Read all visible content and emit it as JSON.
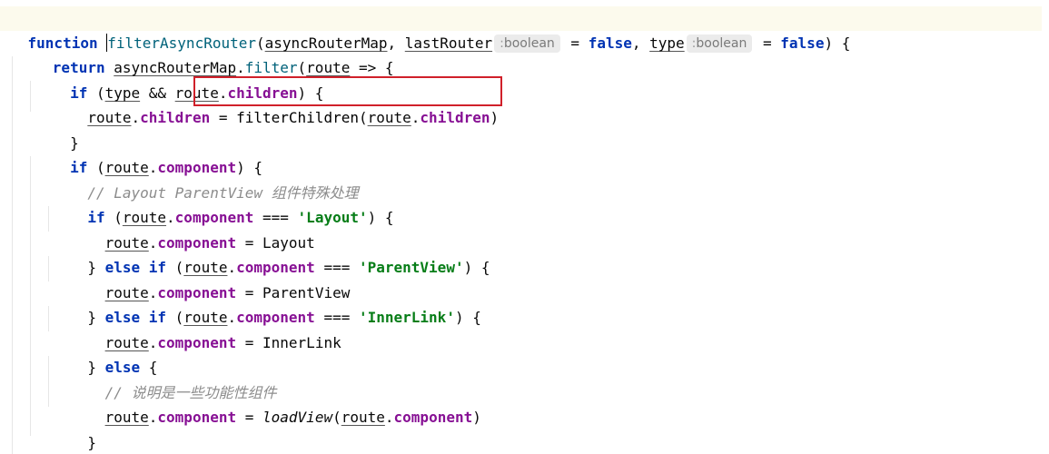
{
  "code": {
    "line1": {
      "kw_function": "function",
      "space1": " ",
      "fn_name": "filterAsyncRouter",
      "paren_open": "(",
      "param1": "asyncRouterMap",
      "comma1": ", ",
      "param2": "lastRouter",
      "hint1_colon": ":",
      "hint1_type": "boolean",
      "eq1": " = ",
      "false1": "false",
      "comma2": ", ",
      "param3": "type",
      "hint2_colon": ":",
      "hint2_type": "boolean",
      "eq2": " = ",
      "false2": "false",
      "tail": ") {"
    },
    "line2": {
      "indent": "  ",
      "kw_return": "return",
      "space": " ",
      "obj": "asyncRouterMap",
      "dot": ".",
      "method": "filter",
      "open": "(",
      "arg": "route",
      "arrow": " => {"
    },
    "line3": {
      "indent": "    ",
      "kw_if": "if",
      "open": " (",
      "v1": "type",
      "and": " && ",
      "v2": "route",
      "dot": ".",
      "prop": "children",
      "close": ") {"
    },
    "line4": {
      "indent": "      ",
      "v1": "route",
      "dot1": ".",
      "prop1": "children",
      "eq": " = ",
      "fn": "filterChildren",
      "open": "(",
      "v2": "route",
      "dot2": ".",
      "prop2": "children",
      "close": ")"
    },
    "line5": {
      "indent": "    ",
      "text": "}"
    },
    "line6": {
      "indent": "    ",
      "kw_if": "if",
      "open": " (",
      "v": "route",
      "dot": ".",
      "prop": "component",
      "close": ") {"
    },
    "line7": {
      "indent": "      ",
      "comment": "// Layout ParentView 组件特殊处理"
    },
    "line8": {
      "indent": "      ",
      "kw_if": "if",
      "open": " (",
      "v": "route",
      "dot": ".",
      "prop": "component",
      "op": " === ",
      "str": "'Layout'",
      "close": ") {"
    },
    "line9": {
      "indent": "        ",
      "v": "route",
      "dot": ".",
      "prop": "component",
      "eq": " = ",
      "val": "Layout"
    },
    "line10": {
      "indent": "      ",
      "brace": "} ",
      "kw_else": "else",
      "sp": " ",
      "kw_if": "if",
      "open": " (",
      "v": "route",
      "dot": ".",
      "prop": "component",
      "op": " === ",
      "str": "'ParentView'",
      "close": ") {"
    },
    "line11": {
      "indent": "        ",
      "v": "route",
      "dot": ".",
      "prop": "component",
      "eq": " = ",
      "val": "ParentView"
    },
    "line12": {
      "indent": "      ",
      "brace": "} ",
      "kw_else": "else",
      "sp": " ",
      "kw_if": "if",
      "open": " (",
      "v": "route",
      "dot": ".",
      "prop": "component",
      "op": " === ",
      "str": "'InnerLink'",
      "close": ") {"
    },
    "line13": {
      "indent": "        ",
      "v": "route",
      "dot": ".",
      "prop": "component",
      "eq": " = ",
      "val": "InnerLink"
    },
    "line14": {
      "indent": "      ",
      "brace": "} ",
      "kw_else": "else",
      "close": " {"
    },
    "line15": {
      "indent": "        ",
      "comment": "// 说明是一些功能性组件"
    },
    "line16": {
      "indent": "        ",
      "v": "route",
      "dot": ".",
      "prop": "component",
      "eq": " = ",
      "fn": "loadView",
      "open": "(",
      "v2": "route",
      "dot2": ".",
      "prop2": "component",
      "close": ")"
    },
    "line17": {
      "indent": "      ",
      "text": "}"
    },
    "line18": {
      "indent": "    ",
      "text": "}"
    }
  },
  "colors": {
    "keyword": "#0033b3",
    "property": "#871094",
    "string": "#067d17",
    "comment": "#8c8c8c",
    "highlight_box": "#d0202a",
    "current_line": "#fcfaed"
  }
}
